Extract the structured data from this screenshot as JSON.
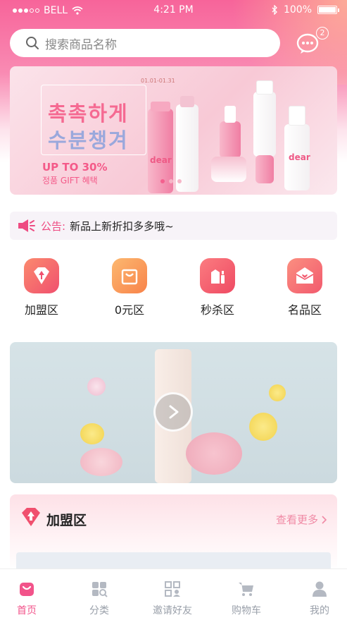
{
  "status_bar": {
    "carrier": "BELL",
    "time": "4:21 PM",
    "battery": "100%"
  },
  "search": {
    "placeholder": "搜索商品名称"
  },
  "messages": {
    "badge_count": "2"
  },
  "banner": {
    "korean_line1": "촉촉하게",
    "korean_line2": "수분챙겨",
    "promo": "UP TO 30%",
    "promo_sub": "정품 GIFT 혜택",
    "date": "01.01-01.31",
    "brand": "dear",
    "active_slide": 1,
    "slide_count": 3
  },
  "notice": {
    "label": "公告:",
    "text": "新品上新折扣多多哦~"
  },
  "categories": [
    {
      "label": "加盟区",
      "icon": "diamond-arrow-icon",
      "color": "#f4607a"
    },
    {
      "label": "0元区",
      "icon": "shopping-bag-icon",
      "color": "#fb9a57"
    },
    {
      "label": "秒杀区",
      "icon": "cosmetics-icon",
      "color": "#f45a6a"
    },
    {
      "label": "名品区",
      "icon": "envelope-heart-icon",
      "color": "#f7707e"
    }
  ],
  "video": {
    "icon": "play-icon"
  },
  "section": {
    "title": "加盟区",
    "more": "查看更多"
  },
  "tabbar": {
    "items": [
      {
        "label": "首页",
        "icon": "home-bag-icon",
        "active": true
      },
      {
        "label": "分类",
        "icon": "category-grid-icon",
        "active": false
      },
      {
        "label": "邀请好友",
        "icon": "qr-code-icon",
        "active": false
      },
      {
        "label": "购物车",
        "icon": "cart-icon",
        "active": false
      },
      {
        "label": "我的",
        "icon": "user-icon",
        "active": false
      }
    ]
  },
  "colors": {
    "accent": "#f2538a",
    "inactive": "#9aa0aa"
  }
}
